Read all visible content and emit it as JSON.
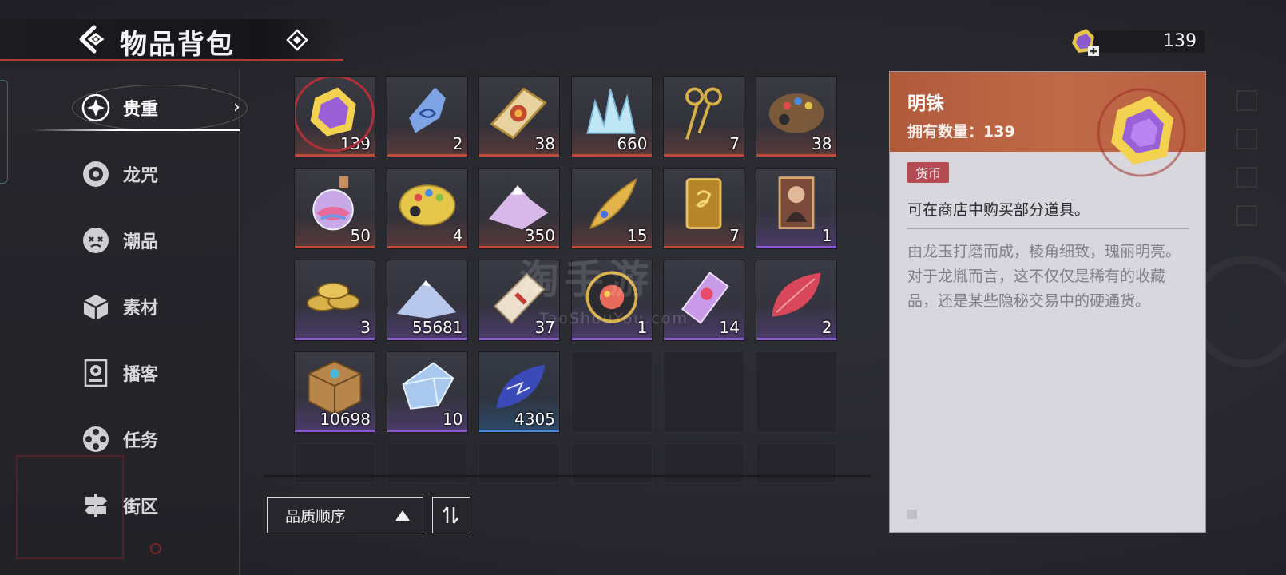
{
  "header": {
    "title": "物品背包"
  },
  "currency": {
    "value": "139",
    "icon": "gem-plus-icon"
  },
  "sidebar": {
    "items": [
      {
        "label": "贵重",
        "icon": "sparkle-icon",
        "active": true
      },
      {
        "label": "龙咒",
        "icon": "disc-icon"
      },
      {
        "label": "潮品",
        "icon": "mask-icon"
      },
      {
        "label": "素材",
        "icon": "cube-icon"
      },
      {
        "label": "播客",
        "icon": "speaker-icon"
      },
      {
        "label": "任务",
        "icon": "film-reel-icon"
      },
      {
        "label": "街区",
        "icon": "signpost-icon"
      }
    ]
  },
  "inventory": {
    "items": [
      {
        "qty": "139",
        "icon": "yellow-gem-icon",
        "rarity": "red",
        "selected": true
      },
      {
        "qty": "2",
        "icon": "blue-crystal-shard-icon",
        "rarity": "red"
      },
      {
        "qty": "38",
        "icon": "gold-ticket-icon",
        "rarity": "red"
      },
      {
        "qty": "660",
        "icon": "ice-crystal-cluster-icon",
        "rarity": "red"
      },
      {
        "qty": "7",
        "icon": "golden-scissors-icon",
        "rarity": "red"
      },
      {
        "qty": "38",
        "icon": "paint-palette-icon",
        "rarity": "red"
      },
      {
        "qty": "50",
        "icon": "potion-flask-icon",
        "rarity": "red"
      },
      {
        "qty": "4",
        "icon": "gold-palette-icon",
        "rarity": "red"
      },
      {
        "qty": "350",
        "icon": "crystal-mound-icon",
        "rarity": "red"
      },
      {
        "qty": "15",
        "icon": "golden-feather-icon",
        "rarity": "red"
      },
      {
        "qty": "7",
        "icon": "gold-pass-card-icon",
        "rarity": "red"
      },
      {
        "qty": "1",
        "icon": "portrait-card-icon",
        "rarity": "purple"
      },
      {
        "qty": "3",
        "icon": "gold-coins-icon",
        "rarity": "purple"
      },
      {
        "qty": "55681",
        "icon": "blue-powder-icon",
        "rarity": "purple"
      },
      {
        "qty": "37",
        "icon": "paper-ticket-icon",
        "rarity": "purple"
      },
      {
        "qty": "1",
        "icon": "badge-token-icon",
        "rarity": "purple"
      },
      {
        "qty": "14",
        "icon": "purple-ticket-icon",
        "rarity": "purple"
      },
      {
        "qty": "2",
        "icon": "red-leaf-icon",
        "rarity": "purple"
      },
      {
        "qty": "10698",
        "icon": "wooden-cube-icon",
        "rarity": "purple"
      },
      {
        "qty": "10",
        "icon": "light-crystal-icon",
        "rarity": "purple"
      },
      {
        "qty": "4305",
        "icon": "blue-leaf-icon",
        "rarity": "blue"
      }
    ]
  },
  "sort": {
    "label": "品质顺序"
  },
  "detail": {
    "name": "明铢",
    "count_label": "拥有数量：139",
    "tag": "货币",
    "short_desc": "可在商店中购买部分道具。",
    "long_desc": "由龙玉打磨而成，棱角细致，瑰丽明亮。对于龙胤而言，这不仅仅是稀有的收藏品，还是某些隐秘交易中的硬通货。"
  },
  "colors": {
    "accent_red": "#b8343a",
    "detail_header": "#b05a3c",
    "tag": "#b44a52"
  }
}
